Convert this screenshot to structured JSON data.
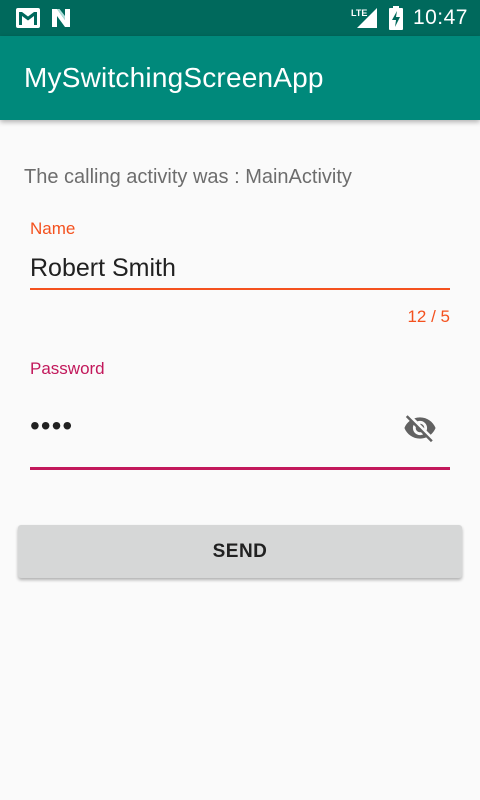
{
  "status_bar": {
    "time": "10:47",
    "network_label": "LTE",
    "left_icons": [
      "gmail-icon",
      "n-notification-icon"
    ],
    "right_icons": [
      "lte-signal-icon",
      "battery-charging-icon"
    ]
  },
  "app_bar": {
    "title": "MySwitchingScreenApp",
    "color": "#00897b",
    "status_color": "#00695c"
  },
  "content": {
    "caller_text": "The calling activity was : MainActivity",
    "name_field": {
      "label": "Name",
      "value": "Robert Smith",
      "counter": "12 / 5",
      "color": "#f4511e"
    },
    "password_field": {
      "label": "Password",
      "value": "••••",
      "toggle_icon": "visibility-off-icon",
      "color": "#c2185b"
    },
    "send_label": "SEND"
  }
}
